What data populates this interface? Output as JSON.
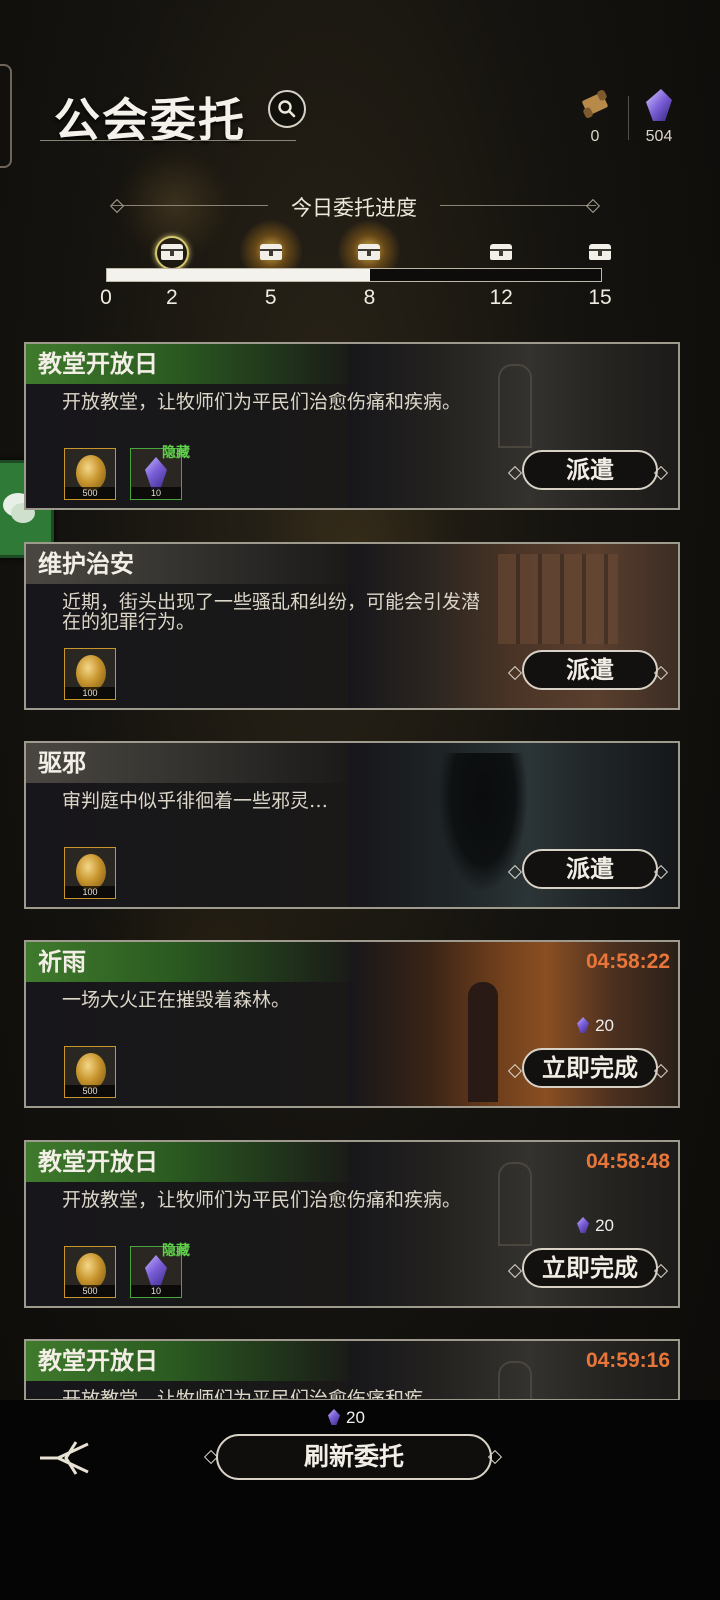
{
  "header": {
    "title": "公会委托",
    "resources": [
      {
        "icon": "scroll-icon",
        "value": "0"
      },
      {
        "icon": "crystal-icon",
        "value": "504"
      }
    ]
  },
  "progress": {
    "title": "今日委托进度",
    "current": 8,
    "max": 15,
    "ticks": [
      "0",
      "2",
      "5",
      "8",
      "12",
      "15"
    ],
    "chests": [
      {
        "at": 2,
        "state": "claimed"
      },
      {
        "at": 5,
        "state": "ready"
      },
      {
        "at": 8,
        "state": "ready"
      },
      {
        "at": 12,
        "state": "locked"
      },
      {
        "at": 15,
        "state": "locked"
      }
    ]
  },
  "quests": [
    {
      "name": "教堂开放日",
      "desc": "开放教堂，让牧师们为平民们治愈伤痛和疾病。",
      "rewards": [
        {
          "type": "coin",
          "qty": "500"
        },
        {
          "type": "crystal",
          "qty": "10",
          "tag": "隐藏"
        }
      ],
      "button": "派遣"
    },
    {
      "name": "维护治安",
      "desc": "近期，街头出现了一些骚乱和纠纷，可能会引发潜在的犯罪行为。",
      "rewards": [
        {
          "type": "coin",
          "qty": "100"
        }
      ],
      "button": "派遣"
    },
    {
      "name": "驱邪",
      "desc": "审判庭中似乎徘徊着一些邪灵…",
      "rewards": [
        {
          "type": "coin",
          "qty": "100"
        }
      ],
      "button": "派遣"
    },
    {
      "name": "祈雨",
      "desc": "一场大火正在摧毁着森林。",
      "timer": "04:58:22",
      "cost": "20",
      "rewards": [
        {
          "type": "coin",
          "qty": "500"
        }
      ],
      "button": "立即完成"
    },
    {
      "name": "教堂开放日",
      "desc": "开放教堂，让牧师们为平民们治愈伤痛和疾病。",
      "timer": "04:58:48",
      "cost": "20",
      "rewards": [
        {
          "type": "coin",
          "qty": "500"
        },
        {
          "type": "crystal",
          "qty": "10",
          "tag": "隐藏"
        }
      ],
      "button": "立即完成"
    },
    {
      "name": "教堂开放日",
      "desc": "开放教堂，让牧师们为平民们治愈伤痛和疾",
      "timer": "04:59:16"
    }
  ],
  "footer": {
    "refresh_cost": "20",
    "refresh_label": "刷新委托"
  },
  "colors": {
    "timer": "#e8763a",
    "hidden_tag": "#5fd14a",
    "title_green": "#3f7a2c"
  }
}
